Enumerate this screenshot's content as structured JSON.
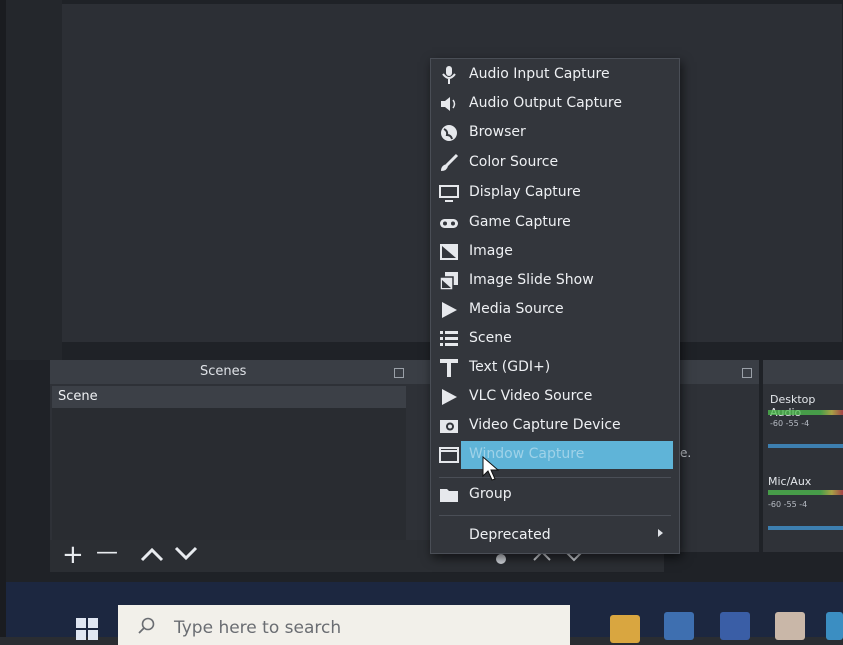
{
  "scenes_dock": {
    "title": "Scenes",
    "items": [
      {
        "label": "Scene"
      }
    ],
    "toolbar": {
      "add": "+",
      "remove": "—",
      "up": "^",
      "down": "v"
    }
  },
  "sources_dock": {
    "hint_fragment": "e."
  },
  "audio_mixer": {
    "channels": [
      {
        "label": "Desktop Audio",
        "ticks": "-60   -55   -4"
      },
      {
        "label": "Mic/Aux",
        "ticks": "-60   -55   -4"
      }
    ]
  },
  "context_menu": {
    "items": [
      {
        "label": "Audio Input Capture",
        "icon": "microphone-icon"
      },
      {
        "label": "Audio Output Capture",
        "icon": "speaker-icon"
      },
      {
        "label": "Browser",
        "icon": "globe-icon"
      },
      {
        "label": "Color Source",
        "icon": "paintbrush-icon"
      },
      {
        "label": "Display Capture",
        "icon": "monitor-icon"
      },
      {
        "label": "Game Capture",
        "icon": "gamepad-icon"
      },
      {
        "label": "Image",
        "icon": "image-icon"
      },
      {
        "label": "Image Slide Show",
        "icon": "slideshow-icon"
      },
      {
        "label": "Media Source",
        "icon": "play-icon"
      },
      {
        "label": "Scene",
        "icon": "list-icon"
      },
      {
        "label": "Text (GDI+)",
        "icon": "text-icon"
      },
      {
        "label": "VLC Video Source",
        "icon": "play-icon"
      },
      {
        "label": "Video Capture Device",
        "icon": "camera-icon"
      },
      {
        "label": "Window Capture",
        "icon": "window-icon",
        "highlighted": true
      },
      {
        "label": "Group",
        "icon": "folder-icon"
      },
      {
        "label": "Deprecated",
        "icon": "",
        "submenu": true
      }
    ]
  },
  "taskbar": {
    "search_placeholder": "Type here to search"
  },
  "colors": {
    "highlight": "#5fb4d8",
    "menu_bg": "#33363c",
    "taskbar": "#1c2740"
  }
}
